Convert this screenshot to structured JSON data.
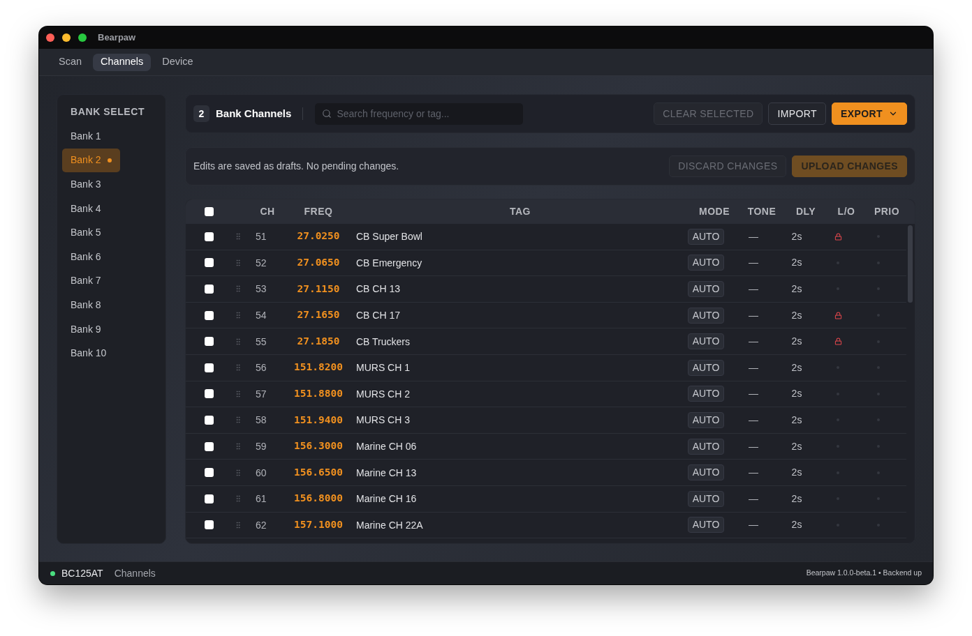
{
  "window": {
    "title": "Bearpaw"
  },
  "tabs": [
    {
      "label": "Scan",
      "selected": false
    },
    {
      "label": "Channels",
      "selected": true
    },
    {
      "label": "Device",
      "selected": false
    }
  ],
  "sidebar": {
    "title": "BANK SELECT",
    "items": [
      {
        "label": "Bank 1",
        "selected": false,
        "modified": false
      },
      {
        "label": "Bank 2",
        "selected": true,
        "modified": true
      },
      {
        "label": "Bank 3",
        "selected": false,
        "modified": false
      },
      {
        "label": "Bank 4",
        "selected": false,
        "modified": false
      },
      {
        "label": "Bank 5",
        "selected": false,
        "modified": false
      },
      {
        "label": "Bank 6",
        "selected": false,
        "modified": false
      },
      {
        "label": "Bank 7",
        "selected": false,
        "modified": false
      },
      {
        "label": "Bank 8",
        "selected": false,
        "modified": false
      },
      {
        "label": "Bank 9",
        "selected": false,
        "modified": false
      },
      {
        "label": "Bank 10",
        "selected": false,
        "modified": false
      }
    ]
  },
  "header": {
    "bank_number": "2",
    "title": "Bank Channels",
    "search": {
      "placeholder": "Search frequency or tag..."
    },
    "buttons": [
      {
        "label": "CLEAR SELECTED",
        "kind": "secondary",
        "disabled": true,
        "has_menu": false
      },
      {
        "label": "IMPORT",
        "kind": "secondary",
        "disabled": false,
        "has_menu": false
      },
      {
        "label": "EXPORT",
        "kind": "primary",
        "disabled": false,
        "has_menu": true
      }
    ]
  },
  "drafts": {
    "message": "Edits are saved as drafts. No pending changes.",
    "buttons": [
      {
        "label": "DISCARD CHANGES",
        "kind": "secondary",
        "disabled": true
      },
      {
        "label": "UPLOAD CHANGES",
        "kind": "primary",
        "disabled": true
      }
    ]
  },
  "table": {
    "select_all": false,
    "columns": [
      "CH",
      "FREQ",
      "TAG",
      "MODE",
      "TONE",
      "DLY",
      "L/O",
      "PRIO"
    ],
    "rows": [
      {
        "checked": false,
        "ch": "51",
        "freq": "27.0250",
        "tag": "CB Super Bowl",
        "mode": "AUTO",
        "tone": "—",
        "delay": "2s",
        "locked_out": true,
        "priority": false
      },
      {
        "checked": false,
        "ch": "52",
        "freq": "27.0650",
        "tag": "CB Emergency",
        "mode": "AUTO",
        "tone": "—",
        "delay": "2s",
        "locked_out": false,
        "priority": false
      },
      {
        "checked": false,
        "ch": "53",
        "freq": "27.1150",
        "tag": "CB CH 13",
        "mode": "AUTO",
        "tone": "—",
        "delay": "2s",
        "locked_out": false,
        "priority": false
      },
      {
        "checked": false,
        "ch": "54",
        "freq": "27.1650",
        "tag": "CB CH 17",
        "mode": "AUTO",
        "tone": "—",
        "delay": "2s",
        "locked_out": true,
        "priority": false
      },
      {
        "checked": false,
        "ch": "55",
        "freq": "27.1850",
        "tag": "CB Truckers",
        "mode": "AUTO",
        "tone": "—",
        "delay": "2s",
        "locked_out": true,
        "priority": false
      },
      {
        "checked": false,
        "ch": "56",
        "freq": "151.8200",
        "tag": "MURS CH 1",
        "mode": "AUTO",
        "tone": "—",
        "delay": "2s",
        "locked_out": false,
        "priority": false
      },
      {
        "checked": false,
        "ch": "57",
        "freq": "151.8800",
        "tag": "MURS CH 2",
        "mode": "AUTO",
        "tone": "—",
        "delay": "2s",
        "locked_out": false,
        "priority": false
      },
      {
        "checked": false,
        "ch": "58",
        "freq": "151.9400",
        "tag": "MURS CH 3",
        "mode": "AUTO",
        "tone": "—",
        "delay": "2s",
        "locked_out": false,
        "priority": false
      },
      {
        "checked": false,
        "ch": "59",
        "freq": "156.3000",
        "tag": "Marine CH 06",
        "mode": "AUTO",
        "tone": "—",
        "delay": "2s",
        "locked_out": false,
        "priority": false
      },
      {
        "checked": false,
        "ch": "60",
        "freq": "156.6500",
        "tag": "Marine CH 13",
        "mode": "AUTO",
        "tone": "—",
        "delay": "2s",
        "locked_out": false,
        "priority": false
      },
      {
        "checked": false,
        "ch": "61",
        "freq": "156.8000",
        "tag": "Marine CH 16",
        "mode": "AUTO",
        "tone": "—",
        "delay": "2s",
        "locked_out": false,
        "priority": false
      },
      {
        "checked": false,
        "ch": "62",
        "freq": "157.1000",
        "tag": "Marine CH 22A",
        "mode": "AUTO",
        "tone": "—",
        "delay": "2s",
        "locked_out": false,
        "priority": false
      }
    ]
  },
  "status_bar": {
    "connected": true,
    "device": "BC125AT",
    "view": "Channels",
    "version": "Bearpaw 1.0.0-beta.1 • Backend up"
  }
}
